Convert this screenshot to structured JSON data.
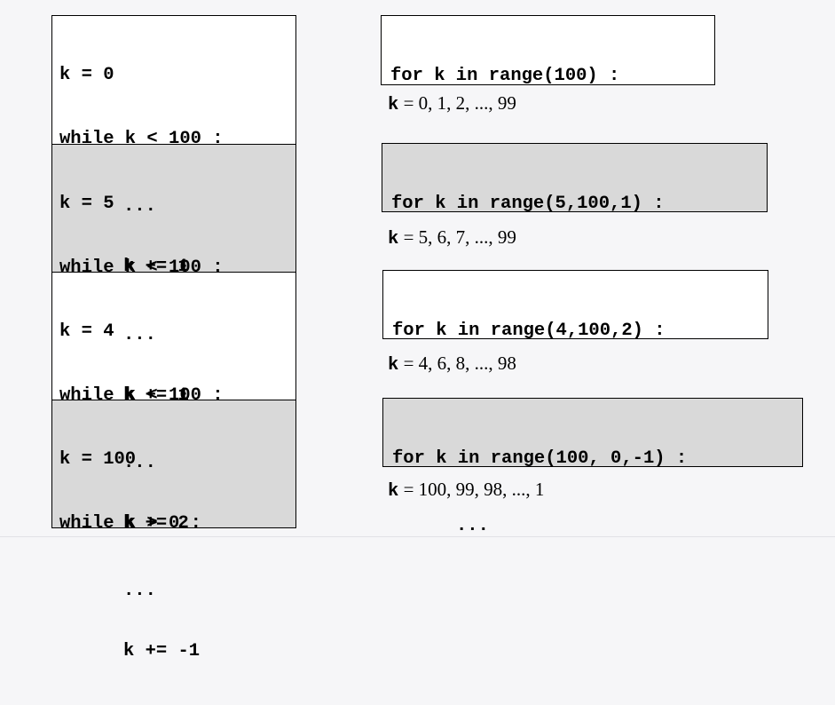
{
  "while_loops": [
    {
      "lines": [
        "k = 0",
        "while k < 100 :",
        "...",
        "k += 1"
      ],
      "shade": "white"
    },
    {
      "lines": [
        "k = 5",
        "while k < 100 :",
        "...",
        "k += 1"
      ],
      "shade": "gray"
    },
    {
      "lines": [
        "k = 4",
        "while k < 100 :",
        "...",
        "k += 2"
      ],
      "shade": "white"
    },
    {
      "lines": [
        "k = 100",
        "while k > 0 :",
        "...",
        "k += -1"
      ],
      "shade": "gray"
    }
  ],
  "for_loops": [
    {
      "header": "for k in range(100) :",
      "body": "...",
      "k_label": "k",
      "eq": " = ",
      "values": "0, 1, 2, ..., 99",
      "shade": "white"
    },
    {
      "header": "for k in range(5,100,1) :",
      "body": "...",
      "k_label": "k",
      "eq": " = ",
      "values": "5, 6, 7, ..., 99",
      "shade": "gray"
    },
    {
      "header": "for k in range(4,100,2) :",
      "body": "...",
      "k_label": "k",
      "eq": " = ",
      "values": "4, 6, 8, ..., 98",
      "shade": "white"
    },
    {
      "header": "for k in range(100, 0,-1) :",
      "body": "...",
      "k_label": "k",
      "eq": " = ",
      "values": "100, 99, 98, ..., 1",
      "shade": "gray"
    }
  ],
  "colors": {
    "white_box": "#ffffff",
    "gray_box": "#d9d9d9",
    "background": "#f6f6f8",
    "border": "#000000"
  }
}
